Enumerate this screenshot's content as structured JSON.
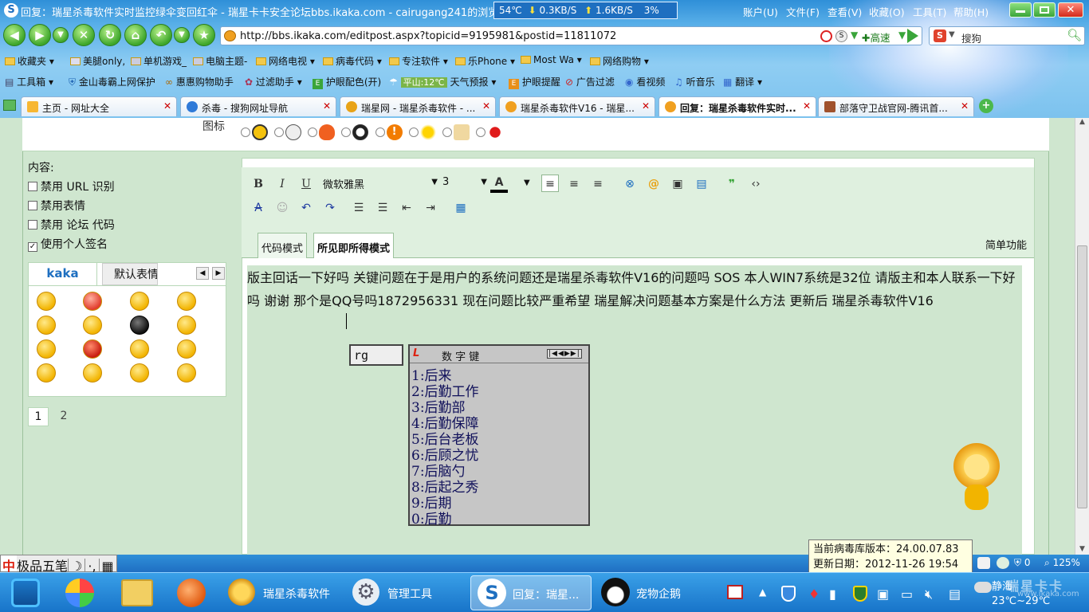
{
  "window": {
    "title": "回复：瑞星杀毒软件实时监控绿伞变回红伞 - 瑞星卡卡安全论坛bbs.ikaka.com - cairugang241的浏览器",
    "status": {
      "temp": "54℃",
      "down": "0.3KB/S",
      "up": "1.6KB/S",
      "cpu": "3%"
    },
    "menu": [
      "账户(U)",
      "文件(F)",
      "查看(V)",
      "收藏(O)",
      "工具(T)",
      "帮助(H)"
    ]
  },
  "nav": {
    "url": "http://bbs.ikaka.com/editpost.aspx?topicid=9195981&postid=11811072",
    "speed_label": "高速",
    "search_label": "搜狗"
  },
  "bookmarks": [
    "收藏夹",
    "美腿only,",
    "单机游戏_",
    "电脑主题-",
    "网络电视",
    "病毒代码",
    "专注软件",
    "乐Phone",
    "Most Wa",
    "网络购物"
  ],
  "toolbar2": [
    "工具箱",
    "金山毒霸上网保护",
    "惠惠购物助手",
    "过滤助手",
    "护眼配色(开)",
    "平山:12℃",
    "天气预报",
    "护眼提醒",
    "广告过滤",
    "看视频",
    "听音乐",
    "翻译"
  ],
  "tabs": [
    {
      "label": "主页 - 网址大全",
      "active": false
    },
    {
      "label": "杀毒 - 搜狗网址导航",
      "active": false
    },
    {
      "label": "瑞星网 - 瑞星杀毒软件 - ...",
      "active": false
    },
    {
      "label": "瑞星杀毒软件V16 - 瑞星...",
      "active": false
    },
    {
      "label": "回复：瑞星杀毒软件实时...",
      "active": true
    },
    {
      "label": "部落守卫战官网-腾讯首...",
      "active": false
    }
  ],
  "page": {
    "icon_label": "图标",
    "content_label": "内容:",
    "options": [
      {
        "label": "禁用 URL 识别",
        "checked": false
      },
      {
        "label": "禁用表情",
        "checked": false
      },
      {
        "label": "禁用 论坛 代码",
        "checked": false
      },
      {
        "label": "使用个人签名",
        "checked": true
      }
    ],
    "smiley_tabs": [
      "kaka",
      "默认表情"
    ],
    "pages": [
      "1",
      "2"
    ]
  },
  "editor": {
    "font": "微软雅黑",
    "size": "3",
    "modes": [
      "代码模式",
      "所见即所得模式"
    ],
    "simple": "简单功能",
    "text": "版主回话一下好吗 关键问题在于是用户的系统问题还是瑞星杀毒软件V16的问题吗  SOS 本人WIN7系统是32位 请版主和本人联系一下好吗 谢谢 那个是QQ号吗1872956331 现在问题比较严重希望 瑞星解决问题基本方案是什么方法 更新后 瑞星杀毒软件V16"
  },
  "ime": {
    "input": "rg",
    "header": "数 字 键",
    "candidates": [
      "1:后来",
      "2:后勤工作",
      "3:后勤部",
      "4:后勤保障",
      "5:后台老板",
      "6:后顾之忧",
      "7:后脑勺",
      "8:后起之秀",
      "9:后期",
      "0:后勤"
    ],
    "bar_label": "极品五笔"
  },
  "tooltip": {
    "line1": "当前病毒库版本：24.00.07.83",
    "line2": "更新日期：2012-11-26 19:54"
  },
  "statusbar": {
    "count": "0",
    "zoom": "125%"
  },
  "taskbar": {
    "items": [
      "瑞星杀毒软件",
      "管理工具",
      "回复：瑞星...",
      "宠物企鹅"
    ],
    "weather_city": "静海",
    "weather_temp": "23℃~29℃",
    "watermark": "瑞星卡卡",
    "watermark_url": "www.ikaka.com"
  },
  "colors": {
    "accent": "#2f8fd8",
    "page_bg": "#cfe6cf",
    "taskbar": "#1874c9"
  }
}
